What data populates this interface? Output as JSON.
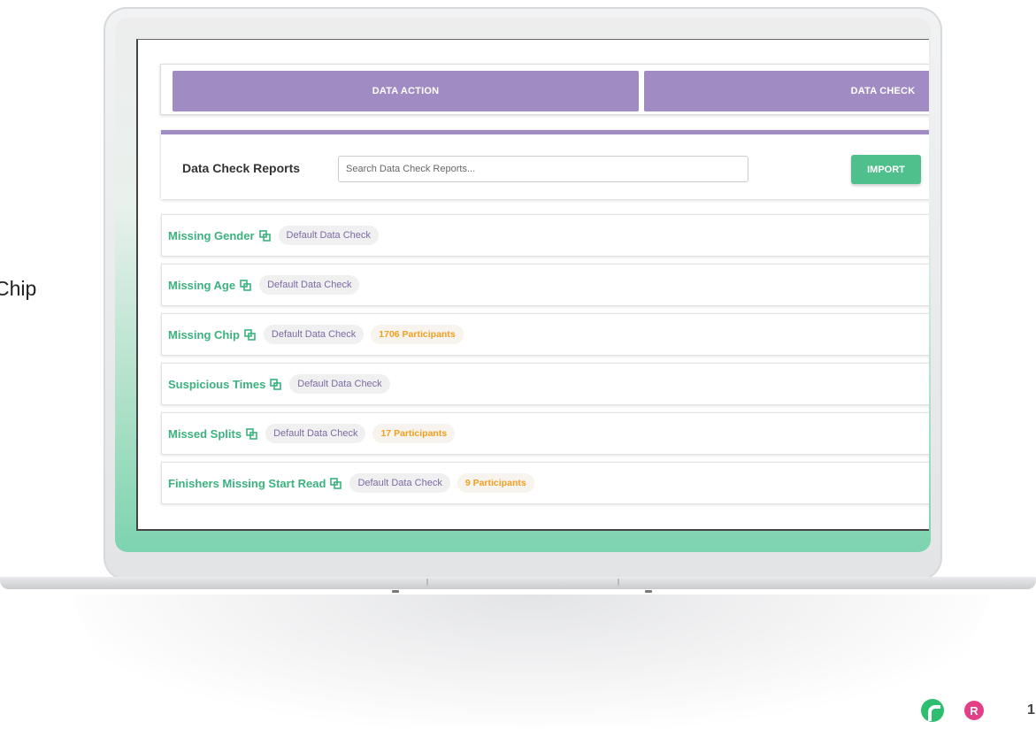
{
  "side_text": "Chip",
  "tabs": [
    {
      "label": "DATA ACTION"
    },
    {
      "label": "DATA CHECK"
    }
  ],
  "reports": {
    "title": "Data Check Reports",
    "search_placeholder": "Search Data Check Reports...",
    "import_label": "IMPORT"
  },
  "items": [
    {
      "title": "Missing Gender",
      "chip": "Default Data Check",
      "participants": ""
    },
    {
      "title": "Missing Age",
      "chip": "Default Data Check",
      "participants": ""
    },
    {
      "title": "Missing Chip",
      "chip": "Default Data Check",
      "participants": "1706 Participants"
    },
    {
      "title": "Suspicious Times",
      "chip": "Default Data Check",
      "participants": ""
    },
    {
      "title": "Missed Splits",
      "chip": "Default Data Check",
      "participants": "17 Participants"
    },
    {
      "title": "Finishers Missing Start Read",
      "chip": "Default Data Check",
      "participants": "9 Participants"
    }
  ],
  "footer": {
    "pink_logo_letter": "R",
    "page_number": "1"
  },
  "colors": {
    "tab_purple": "#a08bc2",
    "title_green": "#3bb27e",
    "import_green": "#4fbf8c",
    "participants_orange": "#f0a020"
  }
}
